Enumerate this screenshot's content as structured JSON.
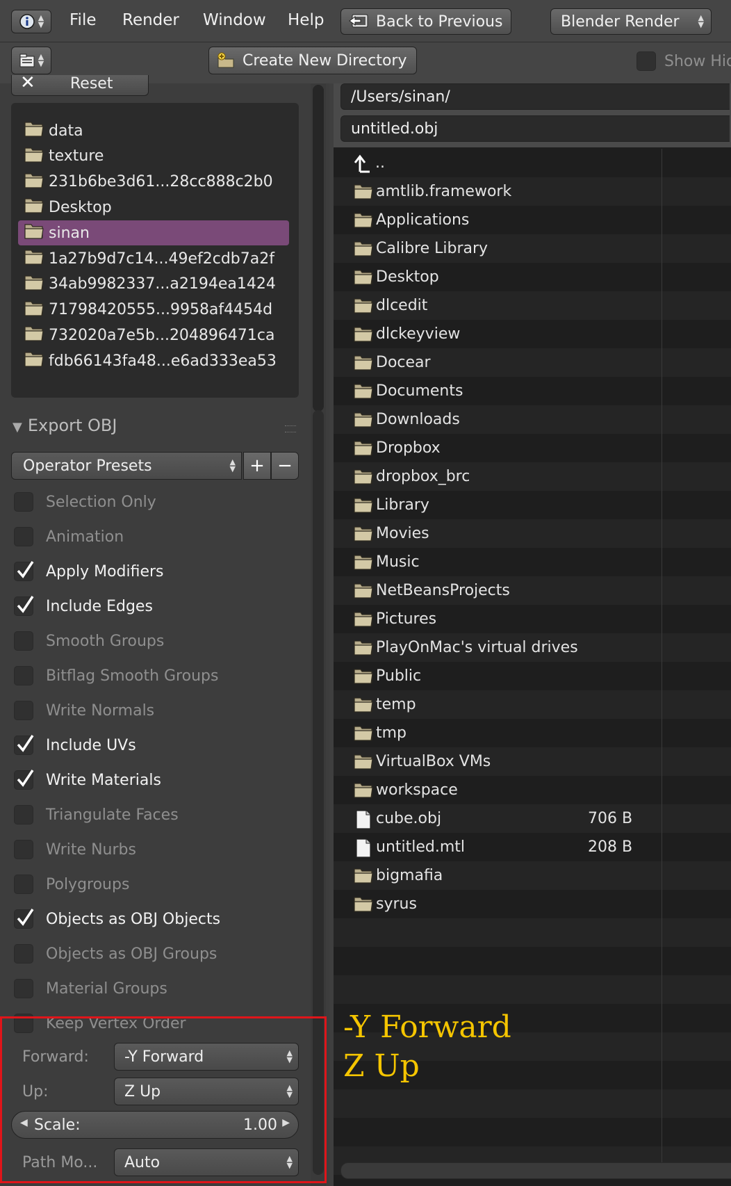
{
  "menubar": {
    "items": [
      "File",
      "Render",
      "Window",
      "Help"
    ],
    "back_label": "Back to Previous",
    "engine": "Blender Render"
  },
  "toolbar": {
    "create_dir_label": "Create New Directory",
    "show_hidden_label": "Show Hid"
  },
  "sidebar": {
    "reset_label": "Reset",
    "bookmarks": [
      {
        "label": "data",
        "selected": false
      },
      {
        "label": "texture",
        "selected": false
      },
      {
        "label": "231b6be3d61...28cc888c2b0",
        "selected": false
      },
      {
        "label": "Desktop",
        "selected": false
      },
      {
        "label": "sinan",
        "selected": true
      },
      {
        "label": "1a27b9d7c14...49ef2cdb7a2f",
        "selected": false
      },
      {
        "label": "34ab9982337...a2194ea1424",
        "selected": false
      },
      {
        "label": "71798420555...9958af4454d",
        "selected": false
      },
      {
        "label": "732020a7e5b...204896471ca",
        "selected": false
      },
      {
        "label": "fdb66143fa48...e6ad333ea53",
        "selected": false
      }
    ],
    "panel_title": "Export OBJ",
    "presets_label": "Operator Presets",
    "options": [
      {
        "label": "Selection Only",
        "checked": false
      },
      {
        "label": "Animation",
        "checked": false
      },
      {
        "label": "Apply Modifiers",
        "checked": true
      },
      {
        "label": "Include Edges",
        "checked": true
      },
      {
        "label": "Smooth Groups",
        "checked": false
      },
      {
        "label": "Bitflag Smooth Groups",
        "checked": false
      },
      {
        "label": "Write Normals",
        "checked": false
      },
      {
        "label": "Include UVs",
        "checked": true
      },
      {
        "label": "Write Materials",
        "checked": true
      },
      {
        "label": "Triangulate Faces",
        "checked": false
      },
      {
        "label": "Write Nurbs",
        "checked": false
      },
      {
        "label": "Polygroups",
        "checked": false
      },
      {
        "label": "Objects as OBJ Objects",
        "checked": true
      },
      {
        "label": "Objects as OBJ Groups",
        "checked": false
      },
      {
        "label": "Material Groups",
        "checked": false
      },
      {
        "label": "Keep Vertex Order",
        "checked": false
      }
    ],
    "forward_label": "Forward:",
    "forward_value": "-Y Forward",
    "up_label": "Up:",
    "up_value": "Z Up",
    "scale_label": "Scale:",
    "scale_value": "1.00",
    "path_mode_label": "Path Mo...",
    "path_mode_value": "Auto"
  },
  "browser": {
    "directory": "/Users/sinan/",
    "filename": "untitled.obj",
    "parent_label": "..",
    "files": [
      {
        "name": "amtlib.framework",
        "type": "folder",
        "size": ""
      },
      {
        "name": "Applications",
        "type": "folder",
        "size": ""
      },
      {
        "name": "Calibre Library",
        "type": "folder",
        "size": ""
      },
      {
        "name": "Desktop",
        "type": "folder",
        "size": ""
      },
      {
        "name": "dlcedit",
        "type": "folder",
        "size": ""
      },
      {
        "name": "dlckeyview",
        "type": "folder",
        "size": ""
      },
      {
        "name": "Docear",
        "type": "folder",
        "size": ""
      },
      {
        "name": "Documents",
        "type": "folder",
        "size": ""
      },
      {
        "name": "Downloads",
        "type": "folder",
        "size": ""
      },
      {
        "name": "Dropbox",
        "type": "folder",
        "size": ""
      },
      {
        "name": "dropbox_brc",
        "type": "folder",
        "size": ""
      },
      {
        "name": "Library",
        "type": "folder",
        "size": ""
      },
      {
        "name": "Movies",
        "type": "folder",
        "size": ""
      },
      {
        "name": "Music",
        "type": "folder",
        "size": ""
      },
      {
        "name": "NetBeansProjects",
        "type": "folder",
        "size": ""
      },
      {
        "name": "Pictures",
        "type": "folder",
        "size": ""
      },
      {
        "name": "PlayOnMac's virtual drives",
        "type": "folder",
        "size": ""
      },
      {
        "name": "Public",
        "type": "folder",
        "size": ""
      },
      {
        "name": "temp",
        "type": "folder",
        "size": ""
      },
      {
        "name": "tmp",
        "type": "folder",
        "size": ""
      },
      {
        "name": "VirtualBox VMs",
        "type": "folder",
        "size": ""
      },
      {
        "name": "workspace",
        "type": "folder",
        "size": ""
      },
      {
        "name": "cube.obj",
        "type": "file",
        "size": "706 B"
      },
      {
        "name": "untitled.mtl",
        "type": "file",
        "size": "208 B"
      },
      {
        "name": "bigmafia",
        "type": "folder",
        "size": ""
      },
      {
        "name": "syrus",
        "type": "folder",
        "size": ""
      }
    ]
  },
  "annotation": {
    "line1": "-Y Forward",
    "line2": "Z Up"
  },
  "colors": {
    "selection": "#7a4a78",
    "highlight_box": "#e0151a",
    "annotation_text": "#f5c500"
  }
}
